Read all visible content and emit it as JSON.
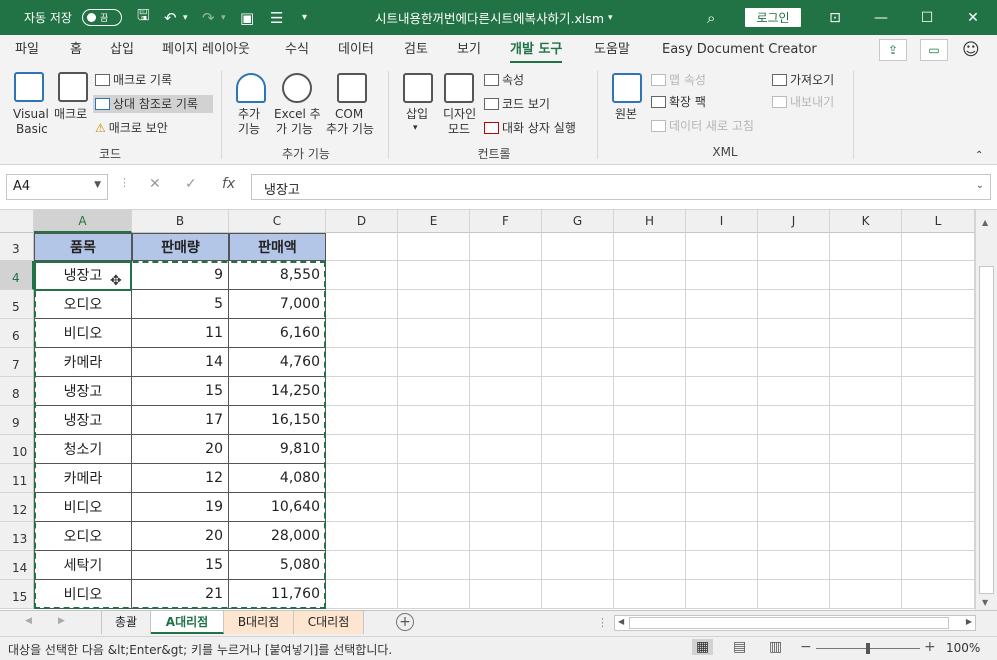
{
  "titlebar": {
    "autosave_label": "자동 저장",
    "autosave_state": "끔",
    "filename": "시트내용한꺼번에다른시트에복사하기.xlsm",
    "filename_caret": "▾",
    "login_label": "로그인"
  },
  "tabs": [
    "파일",
    "홈",
    "삽입",
    "페이지 레이아웃",
    "수식",
    "데이터",
    "검토",
    "보기",
    "개발 도구",
    "도움말",
    "Easy Document Creator"
  ],
  "active_tab": "개발 도구",
  "ribbon": {
    "code": {
      "group": "코드",
      "visual_basic": [
        "Visual",
        "Basic"
      ],
      "macro": "매크로",
      "record_macro": "매크로 기록",
      "relative_ref": "상대 참조로 기록",
      "macro_security": "매크로 보안"
    },
    "addins": {
      "group": "추가 기능",
      "addins": [
        "추가",
        "기능"
      ],
      "excel_addins": [
        "Excel 추",
        "가 기능"
      ],
      "com_addins": [
        "COM",
        "추가 기능"
      ]
    },
    "controls": {
      "group": "컨트롤",
      "insert": "삽입",
      "design_mode": [
        "디자인",
        "모드"
      ],
      "properties": "속성",
      "view_code": "코드 보기",
      "run_dialog": "대화 상자 실행"
    },
    "xml": {
      "group": "XML",
      "source": "원본",
      "map_properties": "맵 속성",
      "expansion_packs": "확장 팩",
      "refresh_data": "데이터 새로 고침",
      "import": "가져오기",
      "export": "내보내기"
    }
  },
  "formula_bar": {
    "namebox": "A4",
    "value": "냉장고"
  },
  "columns": [
    "A",
    "B",
    "C",
    "D",
    "E",
    "F",
    "G",
    "H",
    "I",
    "J",
    "K",
    "L"
  ],
  "header_row": {
    "row": "3",
    "cells": [
      "품목",
      "판매량",
      "판매액"
    ]
  },
  "rows": [
    {
      "row": "4",
      "item": "냉장고",
      "qty": "9",
      "amount": "8,550"
    },
    {
      "row": "5",
      "item": "오디오",
      "qty": "5",
      "amount": "7,000"
    },
    {
      "row": "6",
      "item": "비디오",
      "qty": "11",
      "amount": "6,160"
    },
    {
      "row": "7",
      "item": "카메라",
      "qty": "14",
      "amount": "4,760"
    },
    {
      "row": "8",
      "item": "냉장고",
      "qty": "15",
      "amount": "14,250"
    },
    {
      "row": "9",
      "item": "냉장고",
      "qty": "17",
      "amount": "16,150"
    },
    {
      "row": "10",
      "item": "청소기",
      "qty": "20",
      "amount": "9,810"
    },
    {
      "row": "11",
      "item": "카메라",
      "qty": "12",
      "amount": "4,080"
    },
    {
      "row": "12",
      "item": "비디오",
      "qty": "19",
      "amount": "10,640"
    },
    {
      "row": "13",
      "item": "오디오",
      "qty": "20",
      "amount": "28,000"
    },
    {
      "row": "14",
      "item": "세탁기",
      "qty": "15",
      "amount": "5,080"
    },
    {
      "row": "15",
      "item": "비디오",
      "qty": "21",
      "amount": "11,760"
    }
  ],
  "sheets": [
    "총괄",
    "A대리점",
    "B대리점",
    "C대리점"
  ],
  "active_sheet": "A대리점",
  "status": {
    "message": "대상을 선택한 다음 &lt;Enter&gt; 키를 누르거나 [붙여넣기]를 선택합니다.",
    "zoom": "100%"
  },
  "colors": {
    "brand": "#217346",
    "header_fill": "#b4c6e7",
    "sheet_tab_fill": "#fde5d0"
  }
}
